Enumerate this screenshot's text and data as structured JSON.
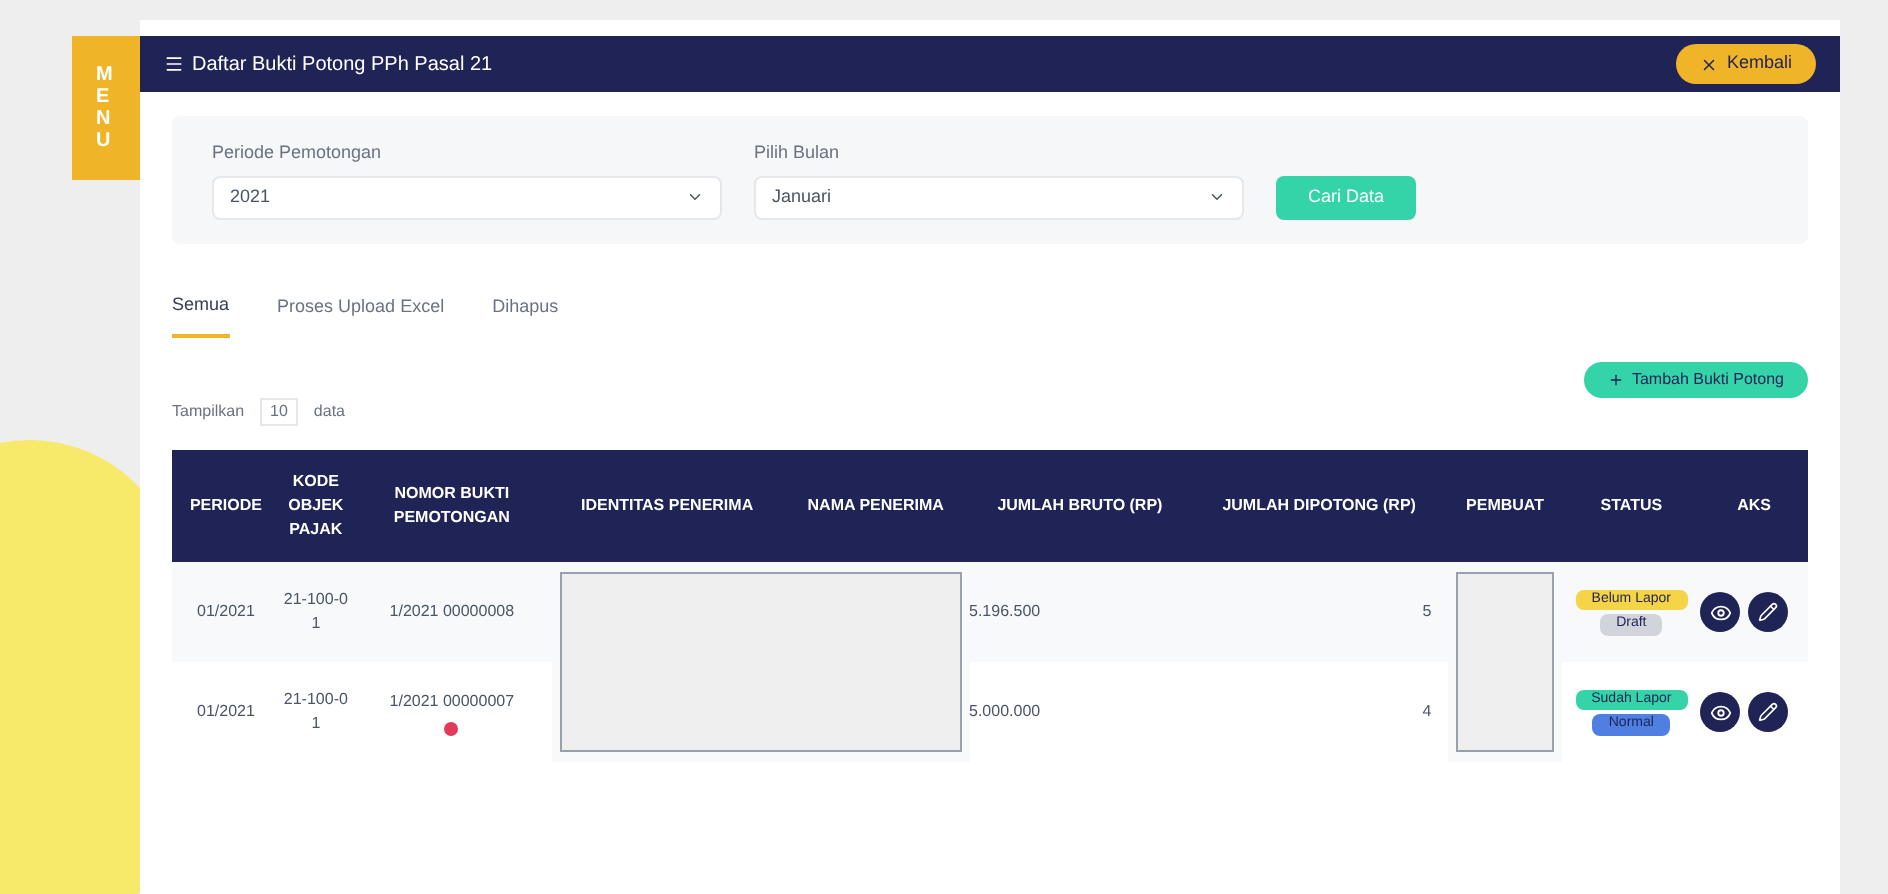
{
  "side_tab": {
    "label": "MENU"
  },
  "header": {
    "title": "Daftar Bukti Potong PPh Pasal 21",
    "button": "Kembali"
  },
  "filters": [
    {
      "label": "Periode Pemotongan",
      "value": "2021",
      "kind": "select"
    },
    {
      "label": "Pilih Bulan",
      "value": "Januari",
      "kind": "select"
    }
  ],
  "search_button": "Cari Data",
  "tabs": [
    {
      "label": "Semua",
      "selected": true
    },
    {
      "label": "Proses Upload Excel",
      "selected": false
    },
    {
      "label": "Dihapus",
      "selected": false
    }
  ],
  "add_button": "Tambah Bukti Potong",
  "page_size": {
    "prefix": "Tampilkan",
    "value": "10",
    "suffix": "data"
  },
  "table": {
    "columns": [
      "PERIODE",
      "KODE OBJEK PAJAK",
      "NOMOR BUKTI PEMOTONGAN",
      "IDENTITAS PENERIMA",
      "NAMA PENERIMA",
      "JUMLAH BRUTO (RP)",
      "JUMLAH DIPOTONG (RP)",
      "PEMBUAT",
      "STATUS",
      "AKS"
    ],
    "rows": [
      {
        "periode": "01/2021",
        "kode": "21-100-01",
        "nomor": "1/2021 00000008",
        "bruto": "5.196.500",
        "dipotong": "5",
        "flag": false,
        "statuses": [
          {
            "label": "Belum Lapor",
            "color": "#f5d547"
          },
          {
            "label": "Draft",
            "color": "#d1d5db"
          }
        ]
      },
      {
        "periode": "01/2021",
        "kode": "21-100-01",
        "nomor": "1/2021 00000007",
        "bruto": "5.000.000",
        "dipotong": "4",
        "flag": true,
        "statuses": [
          {
            "label": "Sudah Lapor",
            "color": "#34d3a8"
          },
          {
            "label": "Normal",
            "color": "#4f7fe0"
          }
        ]
      }
    ]
  }
}
